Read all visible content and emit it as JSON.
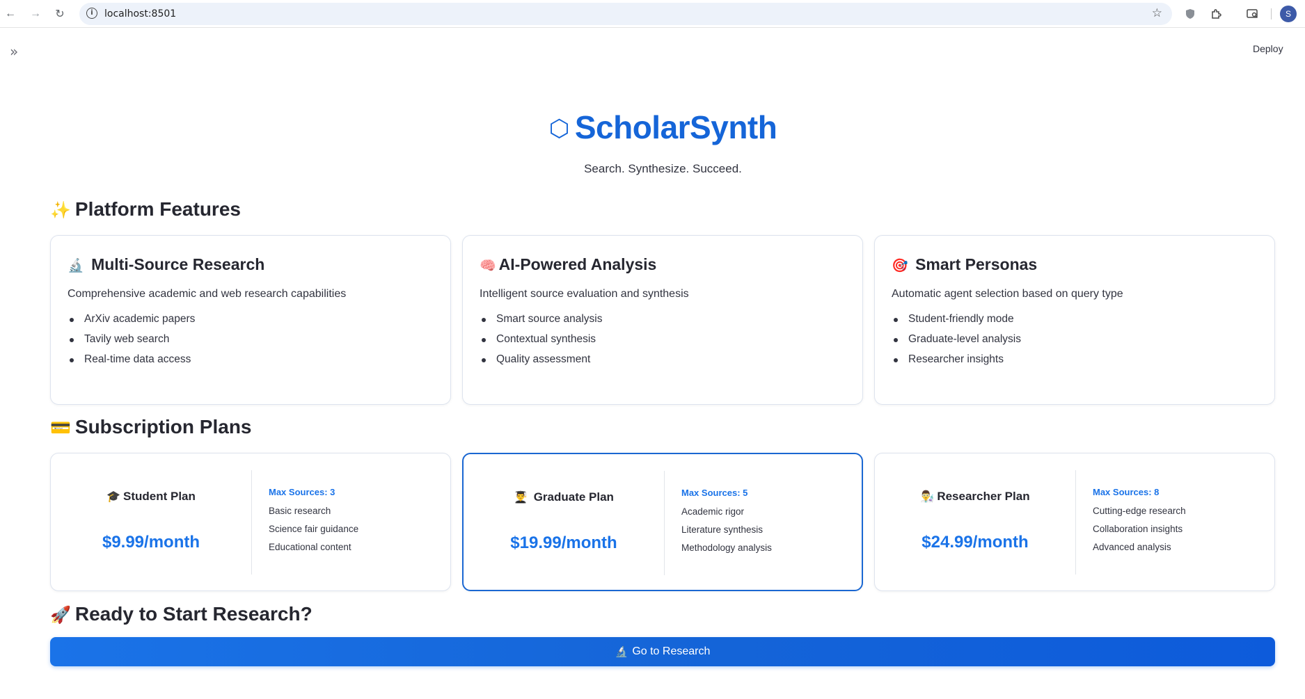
{
  "browser": {
    "url": "localhost:8501",
    "info_icon": "i",
    "back_icon": "←",
    "forward_icon": "→",
    "reload_icon": "↻",
    "star_icon": "☆",
    "profile_initial": "S"
  },
  "app": {
    "sidebar_toggle": "»",
    "deploy_label": "Deploy"
  },
  "hero": {
    "icon": "⬡",
    "title": "ScholarSynth",
    "subtitle": "Search. Synthesize. Succeed."
  },
  "features_section": {
    "emoji": "✨",
    "title": "Platform Features",
    "cards": [
      {
        "emoji": "🔬",
        "title": "Multi-Source Research",
        "description": "Comprehensive academic and web research capabilities",
        "items": [
          "ArXiv academic papers",
          "Tavily web search",
          "Real-time data access"
        ]
      },
      {
        "emoji": "🧠",
        "title": "AI-Powered Analysis",
        "description": "Intelligent source evaluation and synthesis",
        "items": [
          "Smart source analysis",
          "Contextual synthesis",
          "Quality assessment"
        ]
      },
      {
        "emoji": "🎯",
        "title": "Smart Personas",
        "description": "Automatic agent selection based on query type",
        "items": [
          "Student-friendly mode",
          "Graduate-level analysis",
          "Researcher insights"
        ]
      }
    ]
  },
  "plans_section": {
    "emoji": "💳",
    "title": "Subscription Plans",
    "plans": [
      {
        "emoji": "🎓",
        "name": "Student Plan",
        "price": "$9.99/month",
        "max_sources": "Max Sources: 3",
        "features": [
          "Basic research",
          "Science fair guidance",
          "Educational content"
        ]
      },
      {
        "emoji": "👨‍🎓",
        "name": "Graduate Plan",
        "price": "$19.99/month",
        "max_sources": "Max Sources: 5",
        "features": [
          "Academic rigor",
          "Literature synthesis",
          "Methodology analysis"
        ]
      },
      {
        "emoji": "👨‍🔬",
        "name": "Researcher Plan",
        "price": "$24.99/month",
        "max_sources": "Max Sources: 8",
        "features": [
          "Cutting-edge research",
          "Collaboration insights",
          "Advanced analysis"
        ]
      }
    ]
  },
  "cta_section": {
    "emoji": "🚀",
    "title": "Ready to Start Research?",
    "button_emoji": "🔬",
    "button_label": "Go to Research"
  },
  "colors": {
    "accent": "#1a73e8",
    "title_blue": "#1565d8",
    "featured_border": "#1a67d2"
  }
}
